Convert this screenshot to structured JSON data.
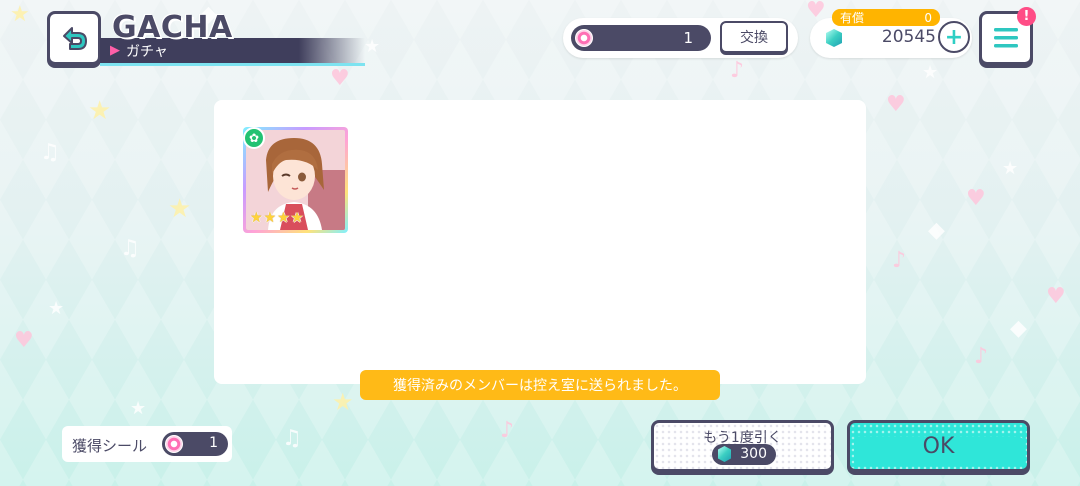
{
  "header": {
    "title_en": "GACHA",
    "title_jp": "ガチャ",
    "back_icon": "back-arrow-icon",
    "menu_icon": "hamburger-menu-icon",
    "menu_alert": "!"
  },
  "currency": {
    "sticker_count": "1",
    "exchange_label": "交換",
    "paid_label": "有償",
    "paid_value": "0",
    "crystal_count": "20545",
    "plus_label": "+"
  },
  "result": {
    "card": {
      "rarity_stars": 4,
      "attribute_icon": "leaf-attribute-icon"
    },
    "notice": "獲得済みのメンバーは控え室に送られました。"
  },
  "footer": {
    "acquired_label": "獲得シール",
    "acquired_value": "1",
    "draw_again_label": "もう1度引く",
    "draw_again_cost": "300",
    "ok_label": "OK"
  },
  "colors": {
    "navy": "#4b4a66",
    "accent_teal": "#2fe6d9",
    "notice_orange": "#ffba17",
    "pink": "#ff5fa8"
  }
}
